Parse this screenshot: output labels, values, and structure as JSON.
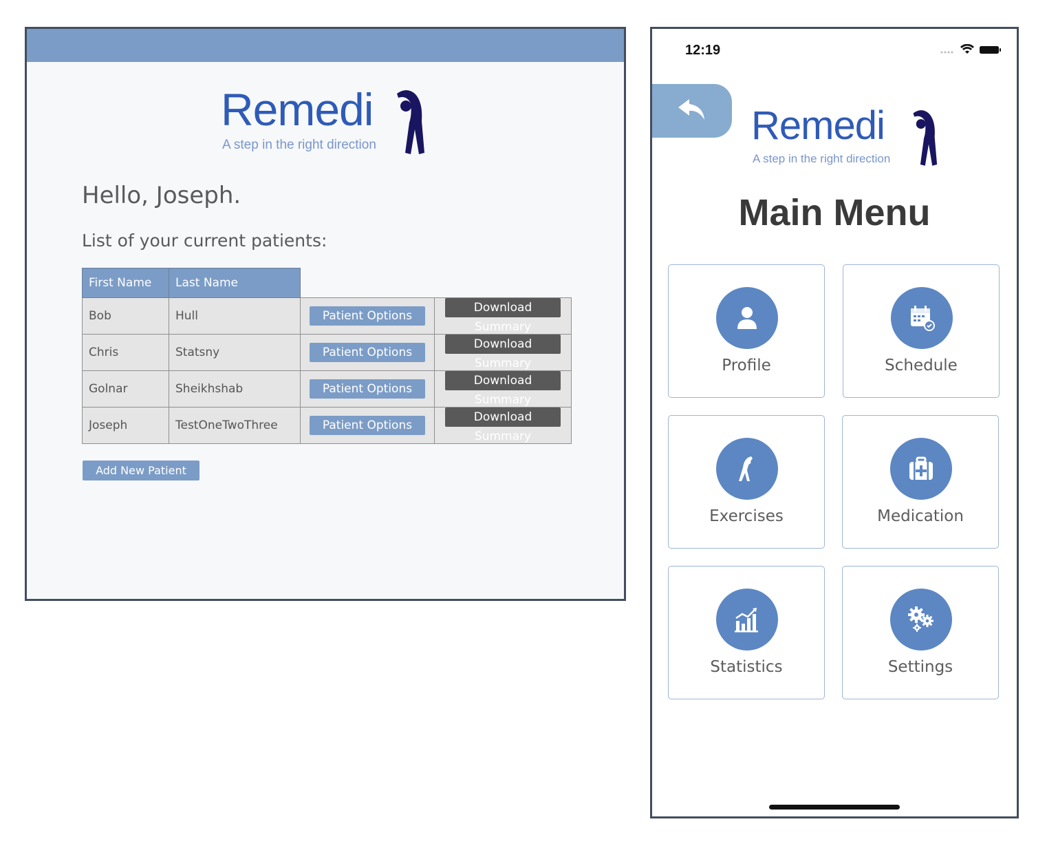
{
  "web": {
    "logo": {
      "word": "Remedi",
      "tagline": "A step in the right direction"
    },
    "greeting": "Hello, Joseph.",
    "list_heading": "List of your current patients:",
    "table": {
      "headers": [
        "First Name",
        "Last Name"
      ],
      "rows": [
        {
          "first": "Bob",
          "last": "Hull",
          "options": "Patient Options",
          "download": "Download Summary"
        },
        {
          "first": "Chris",
          "last": "Statsny",
          "options": "Patient Options",
          "download": "Download Summary"
        },
        {
          "first": "Golnar",
          "last": "Sheikhshab",
          "options": "Patient Options",
          "download": "Download Summary"
        },
        {
          "first": "Joseph",
          "last": "TestOneTwoThree",
          "options": "Patient Options",
          "download": "Download Summary"
        }
      ]
    },
    "add_button": "Add New Patient",
    "colors": {
      "accent": "#7b9cc6",
      "download": "#595959",
      "logo": "#2f5bb7",
      "figure": "#1a1560"
    }
  },
  "phone": {
    "status": {
      "time": "12:19"
    },
    "back_icon": "back-arrow-icon",
    "logo": {
      "word": "Remedi",
      "tagline": "A step in the right direction"
    },
    "title": "Main Menu",
    "tiles": [
      {
        "label": "Profile",
        "icon": "person-icon"
      },
      {
        "label": "Schedule",
        "icon": "calendar-icon"
      },
      {
        "label": "Exercises",
        "icon": "stretch-icon"
      },
      {
        "label": "Medication",
        "icon": "first-aid-kit-icon"
      },
      {
        "label": "Statistics",
        "icon": "bar-chart-icon"
      },
      {
        "label": "Settings",
        "icon": "gears-icon"
      }
    ],
    "colors": {
      "tile_circle": "#5c87c3",
      "back_button": "#88abd0"
    }
  }
}
